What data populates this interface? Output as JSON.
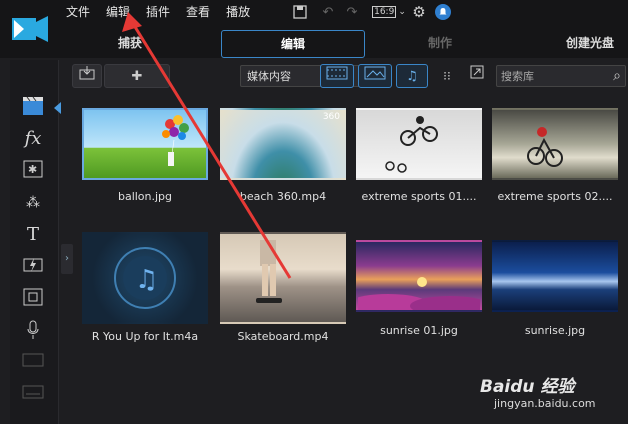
{
  "menu": [
    "文件",
    "编辑",
    "插件",
    "查看",
    "播放"
  ],
  "toolbar_top": {
    "aspect_label": "16:9"
  },
  "modes": [
    "捕获",
    "编辑",
    "制作",
    "创建光盘"
  ],
  "library": {
    "dropdown_value": "媒体内容",
    "search_placeholder": "搜索库"
  },
  "media": [
    {
      "name": "ballon.jpg",
      "selected": true
    },
    {
      "name": "beach 360.mp4",
      "badge": "360"
    },
    {
      "name": "extreme sports 01...."
    },
    {
      "name": "extreme sports 02...."
    },
    {
      "name": "R You Up for It.m4a"
    },
    {
      "name": "Skateboard.mp4"
    },
    {
      "name": "sunrise 01.jpg"
    },
    {
      "name": "sunrise.jpg"
    }
  ],
  "watermark": {
    "main": "Baidu 经验",
    "sub": "jingyan.baidu.com"
  },
  "colors": {
    "accent": "#3a86c8",
    "annotation_arrow": "#e53935"
  }
}
